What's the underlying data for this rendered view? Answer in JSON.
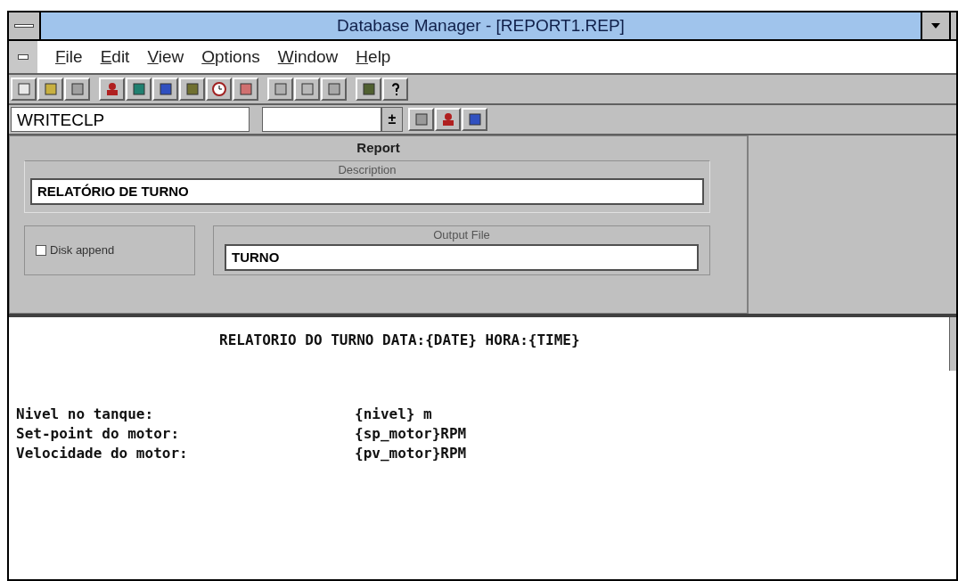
{
  "window": {
    "title": "Database Manager - [REPORT1.REP]"
  },
  "menu": [
    {
      "label": "File"
    },
    {
      "label": "Edit"
    },
    {
      "label": "View"
    },
    {
      "label": "Options"
    },
    {
      "label": "Window"
    },
    {
      "label": "Help"
    }
  ],
  "selector": {
    "value": "WRITECLP",
    "arrow": "±"
  },
  "report": {
    "title": "Report",
    "description_label": "Description",
    "description": "RELATÓRIO DE TURNO",
    "disk_append": {
      "label": "Disk append",
      "checked": false
    },
    "output_label": "Output File",
    "output_file": "TURNO"
  },
  "editor": {
    "heading": "RELATORIO DO TURNO DATA:{DATE} HORA:{TIME}",
    "lines": [
      {
        "label": "Nivel no tanque:",
        "value": "{nivel} m"
      },
      {
        "label": "Set-point do motor:",
        "value": "{sp_motor}RPM"
      },
      {
        "label": "Velocidade do motor:",
        "value": "{pv_motor}RPM"
      }
    ]
  }
}
